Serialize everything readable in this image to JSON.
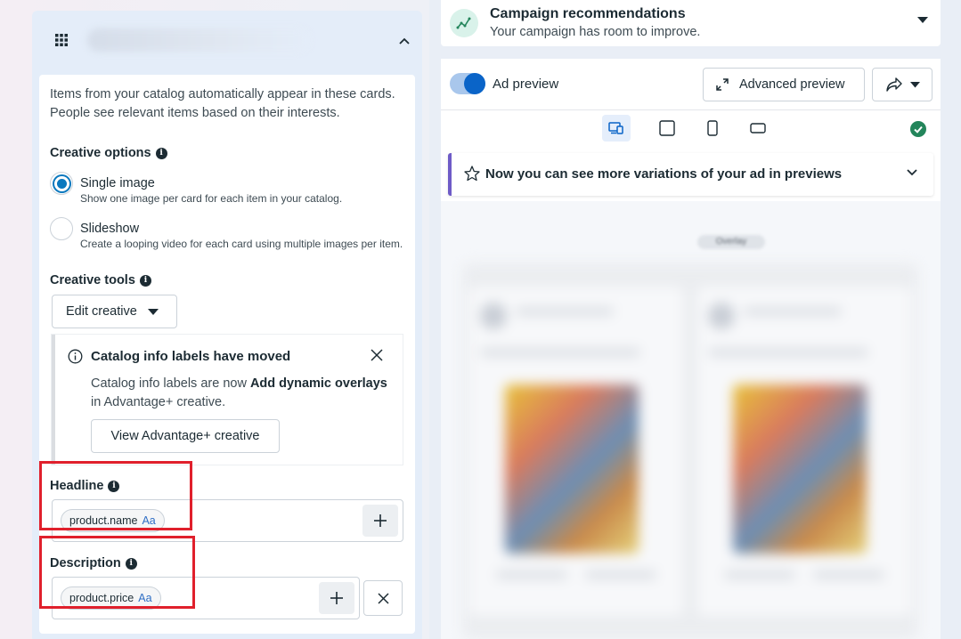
{
  "left_panel": {
    "intro": "Items from your catalog automatically appear in these cards. People see relevant items based on their interests.",
    "creative_options_label": "Creative options",
    "options": [
      {
        "title": "Single image",
        "desc": "Show one image per card for each item in your catalog.",
        "checked": true
      },
      {
        "title": "Slideshow",
        "desc": "Create a looping video for each card using multiple images per item.",
        "checked": false
      }
    ],
    "creative_tools_label": "Creative tools",
    "edit_creative_label": "Edit creative",
    "notice": {
      "title": "Catalog info labels have moved",
      "body_prefix": "Catalog info labels are now ",
      "body_bold": "Add dynamic overlays",
      "body_suffix": " in Advantage+ creative.",
      "button": "View Advantage+ creative"
    },
    "headline": {
      "label": "Headline",
      "chip": "product.name",
      "chip_format": "Aa"
    },
    "description": {
      "label": "Description",
      "chip": "product.price",
      "chip_format": "Aa"
    },
    "highlight_color": "#e0202c"
  },
  "right_panel": {
    "recommendations": {
      "title": "Campaign recommendations",
      "subtitle": "Your campaign has room to improve."
    },
    "ad_preview_label": "Ad preview",
    "ad_preview_on": true,
    "advanced_preview_label": "Advanced preview",
    "devices": [
      "desktop-mobile-icon",
      "square-icon",
      "phone-icon",
      "landscape-icon"
    ],
    "variations_banner": "Now you can see more variations of your ad in previews",
    "overlay_pill": "Overlay",
    "accent_color": "#0a64c8",
    "status_color": "#23855b"
  }
}
